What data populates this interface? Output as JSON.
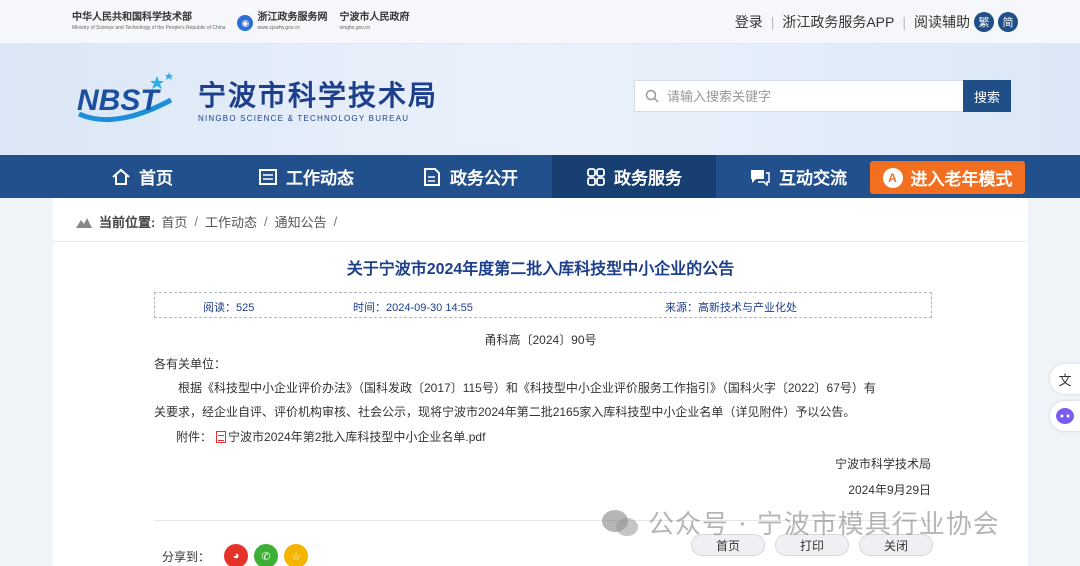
{
  "topbar": {
    "left_links": [
      {
        "main": "中华人民共和国科学技术部",
        "sub": "Ministry of Science and Technology of the People's Republic of China"
      },
      {
        "main": "浙江政务服务网",
        "sub": "www.zjzwfw.gov.cn"
      },
      {
        "main": "宁波市人民政府",
        "sub": "ningbo.gov.cn"
      }
    ],
    "login": "登录",
    "app": "浙江政务服务APP",
    "reader": "阅读辅助",
    "trad": "繁",
    "simp": "简"
  },
  "header": {
    "logo_text": "NBST",
    "title": "宁波市科学技术局",
    "subtitle": "NINGBO SCIENCE & TECHNOLOGY BUREAU",
    "search_placeholder": "请输入搜索关键字",
    "search_button": "搜索"
  },
  "nav": {
    "items": [
      {
        "label": "首页",
        "icon": "home-icon"
      },
      {
        "label": "工作动态",
        "icon": "news-icon"
      },
      {
        "label": "政务公开",
        "icon": "document-icon"
      },
      {
        "label": "政务服务",
        "icon": "grid-icon"
      },
      {
        "label": "互动交流",
        "icon": "chat-icon"
      }
    ],
    "elder_mode": "进入老年模式",
    "elder_badge": "A"
  },
  "breadcrumb": {
    "label": "当前位置:",
    "items": [
      "首页",
      "工作动态",
      "通知公告"
    ]
  },
  "article": {
    "title": "关于宁波市2024年度第二批入库科技型中小企业的公告",
    "meta": {
      "views": "阅读：525",
      "time": "时间：2024-09-30 14:55",
      "source": "来源：高新技术与产业化处"
    },
    "doc_no": "甬科高〔2024〕90号",
    "salutation": "各有关单位：",
    "para1_line1": "根据《科技型中小企业评价办法》（国科发政〔2017〕115号）和《科技型中小企业评价服务工作指引》（国科火字〔2022〕67号）有",
    "para1_line2": "关要求，经企业自评、评价机构审核、社会公示，现将宁波市2024年第二批2165家入库科技型中小企业名单（详见附件）予以公告。",
    "attachment_label": "附件：",
    "attachment_file": "宁波市2024年第2批入库科技型中小企业名单.pdf",
    "sign_org": "宁波市科学技术局",
    "sign_date": "2024年9月29日"
  },
  "share": {
    "label": "分享到：",
    "icons": [
      "weibo-icon",
      "wechat-icon",
      "favorite-icon"
    ]
  },
  "bottom_buttons": {
    "home": "首页",
    "print": "打印",
    "close": "关闭"
  },
  "watermark": "公众号 · 宁波市模具行业协会",
  "colors": {
    "nav_bg": "#22508c",
    "elder_orange": "#f36f20",
    "title_blue": "#1d3f8c"
  }
}
